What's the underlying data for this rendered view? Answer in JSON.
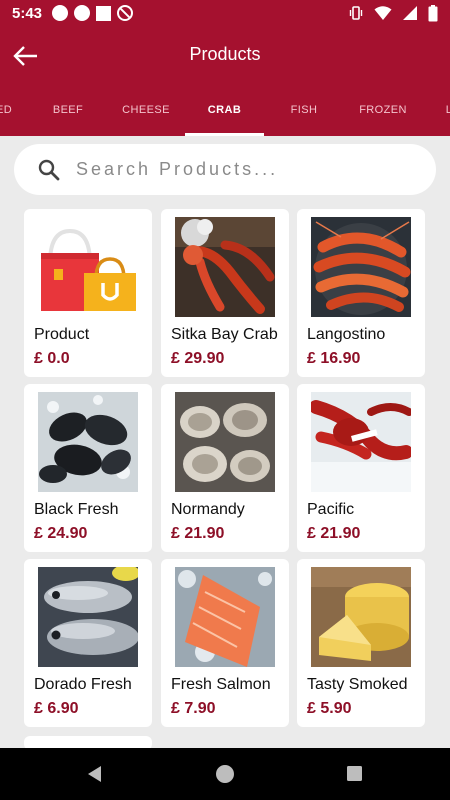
{
  "status_bar": {
    "time": "5:43"
  },
  "header": {
    "title": "Products"
  },
  "tabs": [
    {
      "label": "ED"
    },
    {
      "label": "BEEF"
    },
    {
      "label": "CHEESE"
    },
    {
      "label": "CRAB",
      "active": true
    },
    {
      "label": "FISH"
    },
    {
      "label": "FROZEN"
    },
    {
      "label": "L"
    }
  ],
  "search": {
    "placeholder": "Search Products..."
  },
  "products": [
    {
      "name": "Product",
      "price": "£ 0.0",
      "icon": "shopping-bags-icon"
    },
    {
      "name": "Sitka Bay Crab",
      "price": "£ 29.90",
      "icon": "crab-image"
    },
    {
      "name": "Langostino",
      "price": "£ 16.90",
      "icon": "langostino-image"
    },
    {
      "name": "Black Fresh",
      "price": "£ 24.90",
      "icon": "mussels-image"
    },
    {
      "name": "Normandy",
      "price": "£ 21.90",
      "icon": "oysters-image"
    },
    {
      "name": "Pacific",
      "price": "£ 21.90",
      "icon": "lobster-image"
    },
    {
      "name": "Dorado Fresh",
      "price": "£ 6.90",
      "icon": "fish-image"
    },
    {
      "name": "Fresh Salmon",
      "price": "£ 7.90",
      "icon": "salmon-image"
    },
    {
      "name": "Tasty Smoked",
      "price": "£ 5.90",
      "icon": "cheese-image"
    }
  ],
  "colors": {
    "primary": "#a5112f",
    "price": "#8d0f27",
    "background": "#ebebeb"
  }
}
